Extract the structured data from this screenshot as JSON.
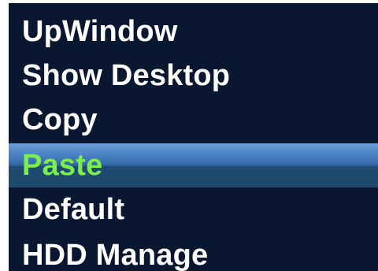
{
  "menu": {
    "items": [
      {
        "label": "UpWindow",
        "selected": false
      },
      {
        "label": "Show Desktop",
        "selected": false
      },
      {
        "label": "Copy",
        "selected": false
      },
      {
        "label": "Paste",
        "selected": true
      },
      {
        "label": "Default",
        "selected": false
      },
      {
        "label": "HDD Manage",
        "selected": false
      }
    ]
  },
  "colors": {
    "panel_background": "#0a1730",
    "item_text": "#ffffff",
    "selected_text": "#7cf04a",
    "selected_highlight": "#3a6fae"
  }
}
